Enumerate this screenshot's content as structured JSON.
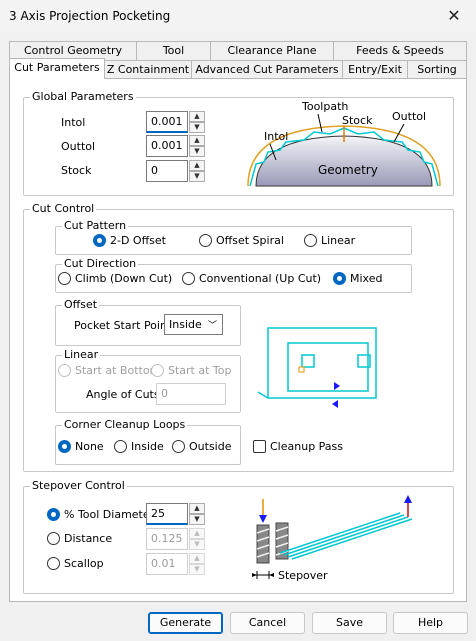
{
  "window": {
    "title": "3 Axis Projection Pocketing",
    "close_glyph": "✕"
  },
  "tabs_row1": [
    "Control Geometry",
    "Tool",
    "Clearance Plane",
    "Feeds & Speeds"
  ],
  "tabs_row2": [
    "Cut Parameters",
    "Z Containment",
    "Advanced Cut Parameters",
    "Entry/Exit",
    "Sorting"
  ],
  "global": {
    "title": "Global Parameters",
    "intol_label": "Intol",
    "intol_value": "0.001",
    "outtol_label": "Outtol",
    "outtol_value": "0.001",
    "stock_label": "Stock",
    "stock_value": "0",
    "diagram": {
      "toolpath": "Toolpath",
      "stock": "Stock",
      "outtol": "Outtol",
      "intol": "Intol",
      "geometry": "Geometry"
    }
  },
  "cut_control": {
    "title": "Cut Control",
    "pattern": {
      "title": "Cut Pattern",
      "options": [
        "2-D Offset",
        "Offset Spiral",
        "Linear"
      ],
      "selected": 0
    },
    "direction": {
      "title": "Cut Direction",
      "options": [
        "Climb (Down Cut)",
        "Conventional (Up Cut)",
        "Mixed"
      ],
      "selected": 2
    },
    "offset": {
      "title": "Offset",
      "pocket_start_label": "Pocket Start Point",
      "pocket_start_value": "Inside"
    },
    "linear": {
      "title": "Linear",
      "start_bottom": "Start at Bottom",
      "start_top": "Start at Top",
      "angle_label": "Angle of Cuts",
      "angle_value": "0"
    },
    "corner": {
      "title": "Corner Cleanup Loops",
      "options": [
        "None",
        "Inside",
        "Outside"
      ],
      "selected": 0
    },
    "cleanup_pass": "Cleanup Pass"
  },
  "stepover": {
    "title": "Stepover Control",
    "tool_diameter_label": "% Tool Diameter",
    "tool_diameter_value": "25",
    "distance_label": "Distance",
    "distance_value": "0.125",
    "scallop_label": "Scallop",
    "scallop_value": "0.01",
    "selected": 0,
    "diagram_label": "Stepover"
  },
  "buttons": {
    "generate": "Generate",
    "cancel": "Cancel",
    "save": "Save",
    "help": "Help"
  },
  "colors": {
    "accent": "#0067c0",
    "toolpath": "#00c8d0",
    "arrow_blue": "#1a1aff",
    "arrow_orange": "#e89000",
    "arrow_red": "#d01010"
  }
}
